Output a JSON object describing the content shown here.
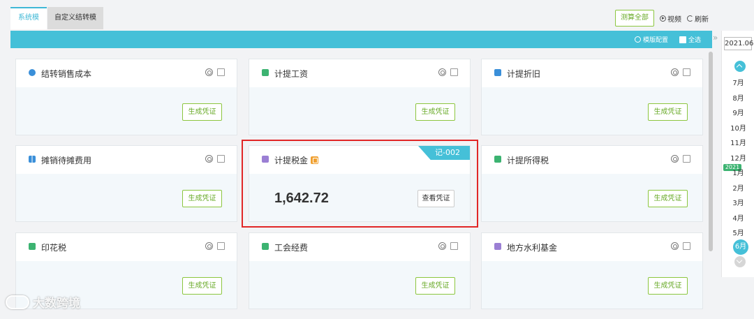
{
  "tabs": [
    {
      "label": "系统模板",
      "active": true
    },
    {
      "label": "自定义结转模版",
      "active": false
    }
  ],
  "toolbar": {
    "calc_all": "测算全部",
    "video": "视频",
    "refresh": "刷新"
  },
  "strip": {
    "template_config": "模版配置",
    "select_all": "全选"
  },
  "cards": [
    {
      "title": "结转销售成本",
      "icon": "money-bag-icon",
      "icon_color": "#3a8fd9",
      "action": "生成凭证"
    },
    {
      "title": "计提工资",
      "icon": "salary-icon",
      "icon_color": "#3cb371",
      "action": "生成凭证"
    },
    {
      "title": "计提折旧",
      "icon": "depreciation-icon",
      "icon_color": "#3a8fd9",
      "action": "生成凭证"
    },
    {
      "title": "摊销待摊费用",
      "icon": "grid-icon",
      "icon_color": "#3a8fd9",
      "action": "生成凭证"
    },
    {
      "title": "计提税金",
      "icon": "tax-stack-icon",
      "icon_color": "#9b7fd4",
      "action": "查看凭证",
      "amount": "1,642.72",
      "voucher": "记-002",
      "highlighted": true
    },
    {
      "title": "计提所得税",
      "icon": "income-tax-icon",
      "icon_color": "#3cb371",
      "action": "生成凭证"
    },
    {
      "title": "印花税",
      "icon": "stamp-tax-icon",
      "icon_color": "#3cb371",
      "action": "生成凭证"
    },
    {
      "title": "工会经费",
      "icon": "union-fund-icon",
      "icon_color": "#3cb371",
      "action": "生成凭证"
    },
    {
      "title": "地方水利基金",
      "icon": "water-fund-icon",
      "icon_color": "#9b7fd4",
      "action": "生成凭证"
    }
  ],
  "period": {
    "current": "2021.06",
    "year_tag": "2021",
    "months": [
      "7月",
      "8月",
      "9月",
      "10月",
      "11月",
      "12月",
      "1月",
      "2月",
      "3月",
      "4月",
      "5月",
      "6月"
    ],
    "selected": "6月"
  },
  "watermark": "大数跨境"
}
